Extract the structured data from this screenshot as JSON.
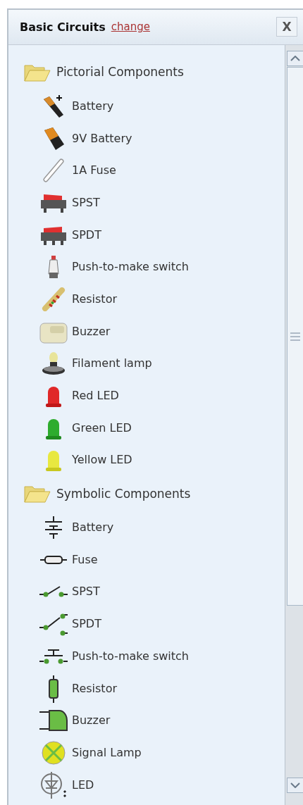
{
  "panel": {
    "title": "Basic Circuits",
    "change_link": "change",
    "close": "X"
  },
  "tree": [
    {
      "label": "Pictorial Components",
      "expanded": true,
      "children": [
        {
          "label": "Battery"
        },
        {
          "label": "9V Battery"
        },
        {
          "label": "1A Fuse"
        },
        {
          "label": "SPST"
        },
        {
          "label": "SPDT"
        },
        {
          "label": "Push-to-make switch"
        },
        {
          "label": "Resistor"
        },
        {
          "label": "Buzzer"
        },
        {
          "label": "Filament lamp"
        },
        {
          "label": "Red LED"
        },
        {
          "label": "Green LED"
        },
        {
          "label": "Yellow LED"
        }
      ]
    },
    {
      "label": "Symbolic Components",
      "expanded": true,
      "children": [
        {
          "label": "Battery"
        },
        {
          "label": "Fuse"
        },
        {
          "label": "SPST"
        },
        {
          "label": "SPDT"
        },
        {
          "label": "Push-to-make switch"
        },
        {
          "label": "Resistor"
        },
        {
          "label": "Buzzer"
        },
        {
          "label": "Signal Lamp"
        },
        {
          "label": "LED"
        }
      ]
    }
  ]
}
